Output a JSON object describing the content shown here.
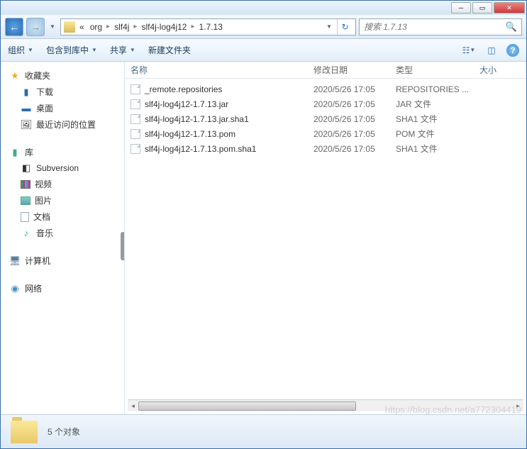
{
  "breadcrumb": {
    "prefix": "«",
    "items": [
      "org",
      "slf4j",
      "slf4j-log4j12",
      "1.7.13"
    ]
  },
  "search": {
    "placeholder": "搜索 1.7.13"
  },
  "toolbar": {
    "organize": "组织",
    "include": "包含到库中",
    "share": "共享",
    "new_folder": "新建文件夹"
  },
  "sidebar": {
    "favorites": {
      "label": "收藏夹",
      "items": [
        "下载",
        "桌面",
        "最近访问的位置"
      ]
    },
    "libraries": {
      "label": "库",
      "items": [
        "Subversion",
        "视频",
        "图片",
        "文档",
        "音乐"
      ]
    },
    "computer": {
      "label": "计算机"
    },
    "network": {
      "label": "网络"
    }
  },
  "columns": {
    "name": "名称",
    "date": "修改日期",
    "type": "类型",
    "size": "大小"
  },
  "files": [
    {
      "name": "_remote.repositories",
      "date": "2020/5/26 17:05",
      "type": "REPOSITORIES ..."
    },
    {
      "name": "slf4j-log4j12-1.7.13.jar",
      "date": "2020/5/26 17:05",
      "type": "JAR 文件"
    },
    {
      "name": "slf4j-log4j12-1.7.13.jar.sha1",
      "date": "2020/5/26 17:05",
      "type": "SHA1 文件"
    },
    {
      "name": "slf4j-log4j12-1.7.13.pom",
      "date": "2020/5/26 17:05",
      "type": "POM 文件"
    },
    {
      "name": "slf4j-log4j12-1.7.13.pom.sha1",
      "date": "2020/5/26 17:05",
      "type": "SHA1 文件"
    }
  ],
  "status": {
    "text": "5 个对象"
  },
  "watermark": "https://blog.csdn.net/a772304419"
}
